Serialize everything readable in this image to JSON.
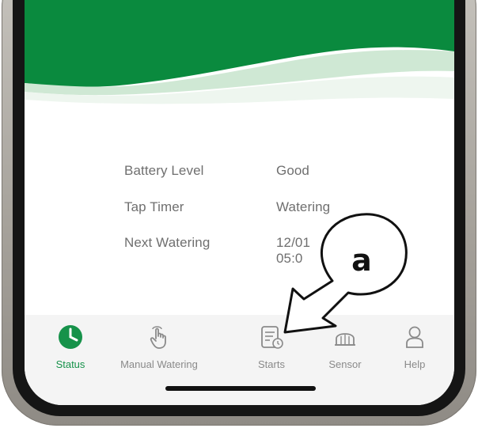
{
  "status_rows": [
    {
      "label": "Battery Level",
      "value": "Good"
    },
    {
      "label": "Tap Timer",
      "value": "Watering"
    },
    {
      "label": "Next Watering",
      "value": "12/01",
      "value2": "05:0"
    }
  ],
  "tabs": [
    {
      "label": "Status",
      "icon": "status-clock-icon",
      "active": true
    },
    {
      "label": "Manual Watering",
      "icon": "hand-touch-icon",
      "active": false
    },
    {
      "label": "Starts",
      "icon": "schedule-document-icon",
      "active": false
    },
    {
      "label": "Sensor",
      "icon": "sensor-dome-icon",
      "active": false
    },
    {
      "label": "Help",
      "icon": "person-icon",
      "active": false
    }
  ],
  "callout": {
    "letter": "a"
  },
  "colors": {
    "brand_green": "#0a8a3e",
    "active_tab": "#16924a",
    "inactive_tab": "#8a8a8a",
    "text": "#6f6f6f"
  }
}
